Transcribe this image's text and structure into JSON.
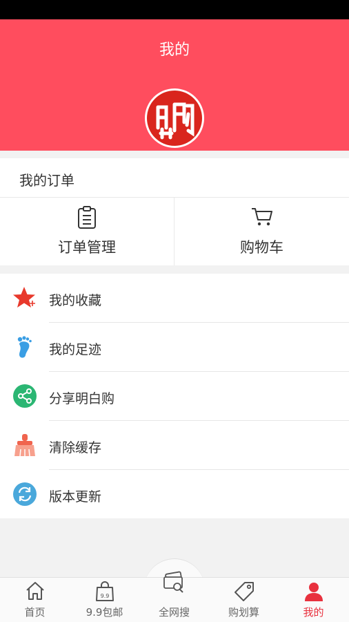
{
  "header": {
    "title": "我的",
    "logo_text": "明白购"
  },
  "orders": {
    "title": "我的订单",
    "items": [
      {
        "label": "订单管理",
        "icon": "clipboard-icon"
      },
      {
        "label": "购物车",
        "icon": "cart-icon"
      }
    ]
  },
  "menu": [
    {
      "label": "我的收藏",
      "icon": "star-plus-icon",
      "color": "#e8392c"
    },
    {
      "label": "我的足迹",
      "icon": "footprint-icon",
      "color": "#3a9ee4"
    },
    {
      "label": "分享明白购",
      "icon": "share-icon",
      "color": "#2bb673"
    },
    {
      "label": "清除缓存",
      "icon": "broom-icon",
      "color": "#f0644e"
    },
    {
      "label": "版本更新",
      "icon": "refresh-icon",
      "color": "#4aa8db"
    }
  ],
  "tabbar": {
    "items": [
      {
        "label": "首页",
        "icon": "home-icon"
      },
      {
        "label": "9.9包邮",
        "icon": "bag-icon"
      },
      {
        "label": "全网搜",
        "icon": "search-cards-icon"
      },
      {
        "label": "购划算",
        "icon": "tag-icon"
      },
      {
        "label": "我的",
        "icon": "user-icon",
        "active": true
      }
    ],
    "active_color": "#e8313e"
  },
  "colors": {
    "accent": "#ff4d5e"
  }
}
